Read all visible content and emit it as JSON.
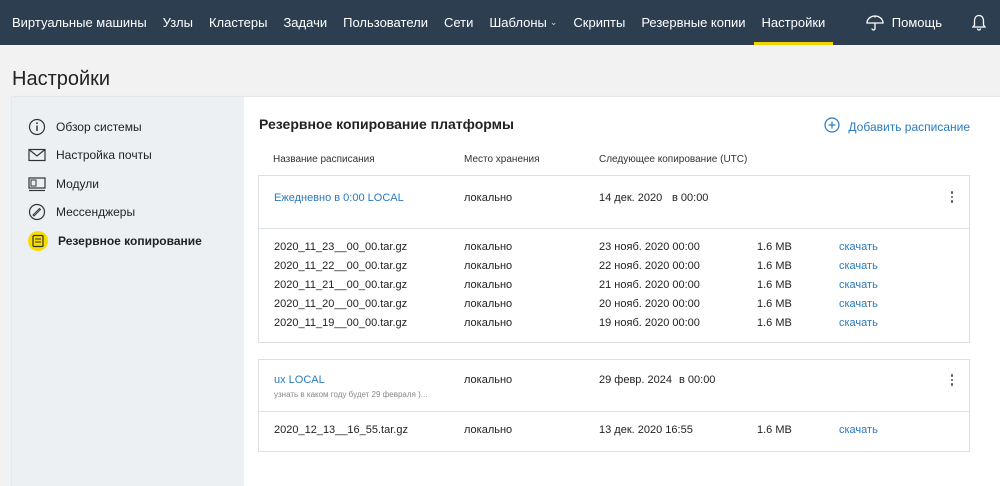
{
  "nav": {
    "items": [
      {
        "label": "Виртуальные машины",
        "active": false
      },
      {
        "label": "Узлы",
        "active": false
      },
      {
        "label": "Кластеры",
        "active": false
      },
      {
        "label": "Задачи",
        "active": false
      },
      {
        "label": "Пользователи",
        "active": false
      },
      {
        "label": "Сети",
        "active": false
      },
      {
        "label": "Шаблоны",
        "active": false,
        "dropdown": true
      },
      {
        "label": "Скрипты",
        "active": false
      },
      {
        "label": "Резервные копии",
        "active": false
      },
      {
        "label": "Настройки",
        "active": true
      }
    ],
    "help_label": "Помощь"
  },
  "page": {
    "title": "Настройки"
  },
  "sidebar": {
    "items": [
      {
        "label": "Обзор системы",
        "icon": "info-icon"
      },
      {
        "label": "Настройка почты",
        "icon": "mail-icon"
      },
      {
        "label": "Модули",
        "icon": "modules-icon"
      },
      {
        "label": "Мессенджеры",
        "icon": "messenger-icon"
      },
      {
        "label": "Резервное копирование",
        "icon": "backup-icon",
        "active": true
      }
    ]
  },
  "main": {
    "title": "Резервное копирование платформы",
    "add_label": "Добавить расписание",
    "columns": [
      "Название расписания",
      "Место хранения",
      "Следующее копирование (UTC)"
    ],
    "schedules": [
      {
        "name": "Ежедневно в 0:00 LOCAL",
        "note": "",
        "storage": "локально",
        "next_date": "14 дек. 2020",
        "next_time": "в 00:00",
        "files": [
          {
            "name": "2020_11_23__00_00.tar.gz",
            "storage": "локально",
            "date": "23 нояб. 2020 00:00",
            "size": "1.6 MB",
            "action": "скачать"
          },
          {
            "name": "2020_11_22__00_00.tar.gz",
            "storage": "локально",
            "date": "22 нояб. 2020 00:00",
            "size": "1.6 MB",
            "action": "скачать"
          },
          {
            "name": "2020_11_21__00_00.tar.gz",
            "storage": "локально",
            "date": "21 нояб. 2020 00:00",
            "size": "1.6 MB",
            "action": "скачать"
          },
          {
            "name": "2020_11_20__00_00.tar.gz",
            "storage": "локально",
            "date": "20 нояб. 2020 00:00",
            "size": "1.6 MB",
            "action": "скачать"
          },
          {
            "name": "2020_11_19__00_00.tar.gz",
            "storage": "локально",
            "date": "19 нояб. 2020 00:00",
            "size": "1.6 MB",
            "action": "скачать"
          }
        ]
      },
      {
        "name": "ux LOCAL",
        "note": "узнать в каком году будет 29 февраля )...",
        "storage": "локально",
        "next_date": "29 февр. 2024",
        "next_time": "в 00:00",
        "files": [
          {
            "name": "2020_12_13__16_55.tar.gz",
            "storage": "локально",
            "date": "13 дек. 2020 16:55",
            "size": "1.6 MB",
            "action": "скачать"
          }
        ]
      }
    ]
  },
  "colors": {
    "nav_bg": "#2c3e50",
    "accent": "#f1d200",
    "link": "#2a7ac0"
  }
}
